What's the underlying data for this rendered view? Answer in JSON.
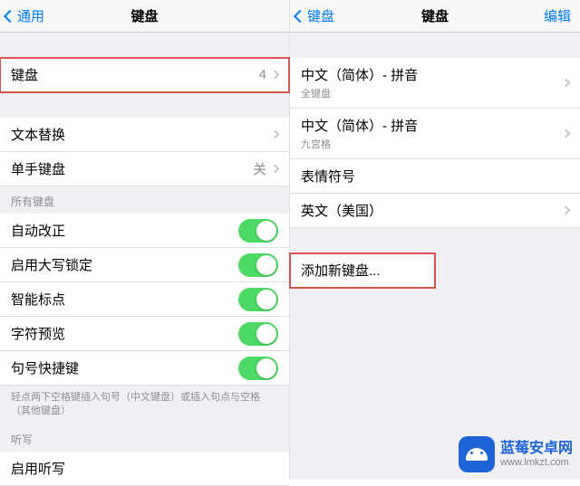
{
  "left": {
    "nav": {
      "back": "通用",
      "title": "键盘"
    },
    "cells": {
      "keyboards": {
        "label": "键盘",
        "value": "4"
      },
      "text_replace": {
        "label": "文本替换"
      },
      "one_hand": {
        "label": "单手键盘",
        "value": "关"
      }
    },
    "section_all": "所有键盘",
    "toggles": {
      "auto_correct": "自动改正",
      "caps_lock": "启用大写锁定",
      "smart_punct": "智能标点",
      "char_preview": "字符预览",
      "period_shortcut": "句号快捷键"
    },
    "footnote": "轻点两下空格键插入句号（中文键盘）或插入句点与空格（其他键盘）",
    "section_dictation": "听写",
    "dictation_toggle": "启用听写"
  },
  "right": {
    "nav": {
      "back": "键盘",
      "title": "键盘",
      "edit": "编辑"
    },
    "keyboards": [
      {
        "label": "中文（简体）- 拼音",
        "sub": "全键盘"
      },
      {
        "label": "中文（简体）- 拼音",
        "sub": "九宫格"
      },
      {
        "label": "表情符号"
      },
      {
        "label": "英文（美国）"
      }
    ],
    "add_new": "添加新键盘..."
  },
  "watermark": {
    "title": "蓝莓安卓网",
    "url": "www.lmkzt.com"
  }
}
